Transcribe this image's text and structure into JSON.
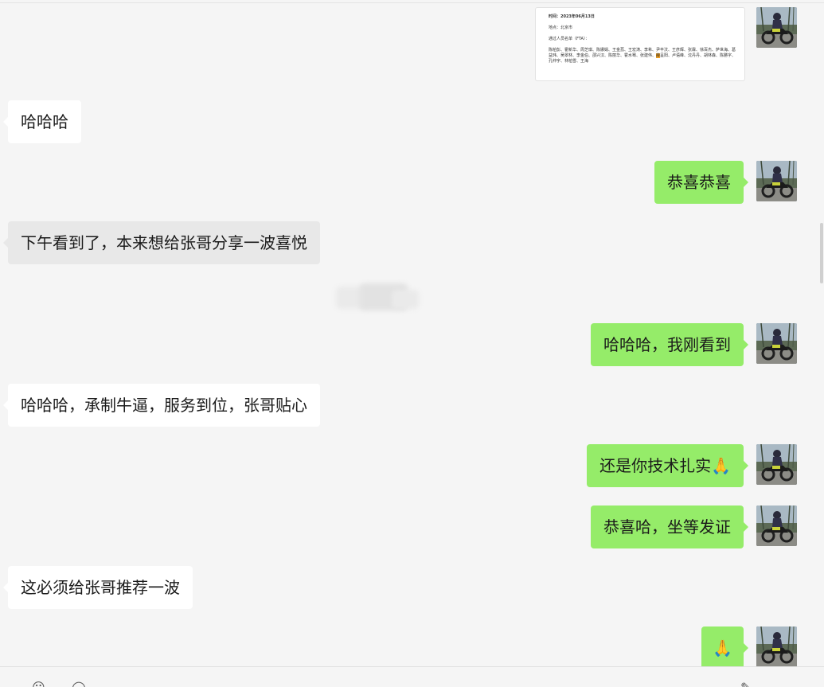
{
  "messages": {
    "m1": "哈哈哈",
    "m2": "恭喜恭喜",
    "m3": "下午看到了，本来想给张哥分享一波喜悦",
    "m4": "哈哈哈，我刚看到",
    "m5": "哈哈哈，承制牛逼，服务到位，张哥贴心",
    "m6": "还是你技术扎实",
    "m7": "恭喜哈，坐等发证",
    "m8": "这必须给张哥推荐一波"
  },
  "emoji": {
    "clasp": "🙏"
  },
  "doc_image": {
    "time_line": "时间：2023年06月13日",
    "place_line": "地点：北京市",
    "list_title": "通过人员名单（FTA）：",
    "names_line": "陈柏彭、霍新华、周芝琪、陈娜娟、王金荔、王宏涛、李希、尹丰汶、王彦辉、张霖、徐百杰、萨世海、葛益玮、吴翠林、李金伯、邵兴汉、陈丽华、霍水骞、张建伟、",
    "names_highlight": "薛",
    "names_line2": "呈阳、卢语峰、沈丹丹、胡林森、陈勝字、孔仲宇、林柏雪、王海"
  },
  "colors": {
    "self_bubble": "#95ec69",
    "other_bubble": "#ffffff",
    "background": "#f5f5f5"
  }
}
